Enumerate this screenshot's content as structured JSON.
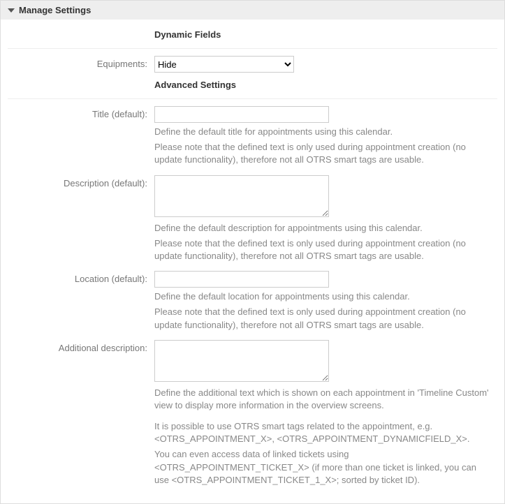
{
  "header": {
    "title": "Manage Settings"
  },
  "sections": {
    "dynamic_fields": {
      "title": "Dynamic Fields",
      "equipments": {
        "label": "Equipments:",
        "selected": "Hide"
      }
    },
    "advanced": {
      "title": "Advanced Settings",
      "title_default": {
        "label": "Title (default):",
        "value": "",
        "help1": "Define the default title for appointments using this calendar.",
        "help2": "Please note that the defined text is only used during appointment creation (no update functionality), therefore not all OTRS smart tags are usable."
      },
      "description_default": {
        "label": "Description (default):",
        "value": "",
        "help1": "Define the default description for appointments using this calendar.",
        "help2": "Please note that the defined text is only used during appointment creation (no update functionality), therefore not all OTRS smart tags are usable."
      },
      "location_default": {
        "label": "Location (default):",
        "value": "",
        "help1": "Define the default location for appointments using this calendar.",
        "help2": "Please note that the defined text is only used during appointment creation (no update functionality), therefore not all OTRS smart tags are usable."
      },
      "additional_description": {
        "label": "Additional description:",
        "value": "",
        "help1": "Define the additional text which is shown on each appointment in 'Timeline Custom' view to display more information in the overview screens.",
        "help2": "It is possible to use OTRS smart tags related to the appointment, e.g. <OTRS_APPOINTMENT_X>, <OTRS_APPOINTMENT_DYNAMICFIELD_X>.",
        "help3": "You can even access data of linked tickets using <OTRS_APPOINTMENT_TICKET_X> (if more than one ticket is linked, you can use <OTRS_APPOINTMENT_TICKET_1_X>; sorted by ticket ID)."
      }
    }
  }
}
